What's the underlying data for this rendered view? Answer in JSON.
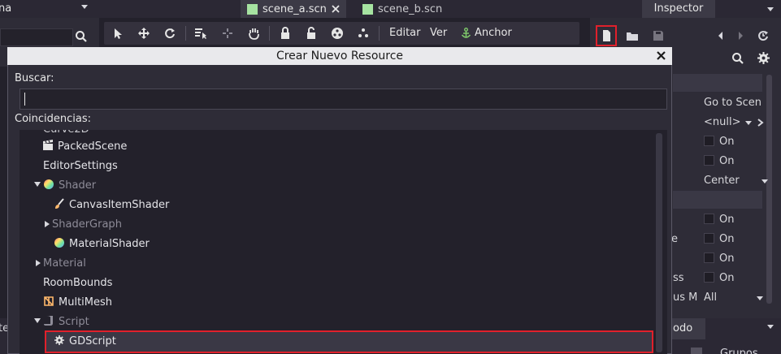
{
  "window": {
    "left_title": "na",
    "tabs": [
      {
        "label": "scene_a.scn",
        "active": true
      },
      {
        "label": "scene_b.scn",
        "active": false
      }
    ],
    "inspector_tab": "Inspector"
  },
  "toolbar": {
    "menu_editar": "Editar",
    "menu_ver": "Ver",
    "anchor_label": "Anchor"
  },
  "inspector": {
    "rows": [
      {
        "label": "Go to Scen"
      },
      {
        "label": "<null>"
      },
      {
        "label": "On"
      },
      {
        "label": "On"
      },
      {
        "label": "Center"
      },
      {
        "label": "On"
      },
      {
        "label": "On"
      },
      {
        "label": "On"
      },
      {
        "label": "On"
      },
      {
        "label": "All"
      }
    ],
    "cut_labels": [
      "e",
      "ss",
      "us M"
    ],
    "bottom_tab": "odo",
    "bottom_cut": "Grupos"
  },
  "dialog": {
    "title": "Crear Nuevo Resource",
    "search_label": "Buscar:",
    "search_value": "",
    "matches_label": "Coincidencias:",
    "partial_top": "Curve2D",
    "items": [
      {
        "label": "PackedScene",
        "kind": "item",
        "icon": "clapperboard-icon"
      },
      {
        "label": "EditorSettings",
        "kind": "item",
        "icon": ""
      },
      {
        "label": "Shader",
        "kind": "cat-open",
        "icon": "shader-sphere-icon"
      },
      {
        "label": "CanvasItemShader",
        "kind": "item",
        "icon": "brush-icon"
      },
      {
        "label": "ShaderGraph",
        "kind": "cat-closed",
        "icon": ""
      },
      {
        "label": "MaterialShader",
        "kind": "item",
        "icon": "shader-sphere-icon"
      },
      {
        "label": "Material",
        "kind": "cat-closed",
        "icon": ""
      },
      {
        "label": "RoomBounds",
        "kind": "item",
        "icon": ""
      },
      {
        "label": "MultiMesh",
        "kind": "item",
        "icon": "multimesh-icon"
      },
      {
        "label": "Script",
        "kind": "cat-open",
        "icon": "script-icon"
      },
      {
        "label": "GDScript",
        "kind": "selected",
        "icon": "gear-icon"
      }
    ]
  },
  "colors": {
    "highlight": "#e0202b",
    "accent_green": "#a6e3a1"
  }
}
